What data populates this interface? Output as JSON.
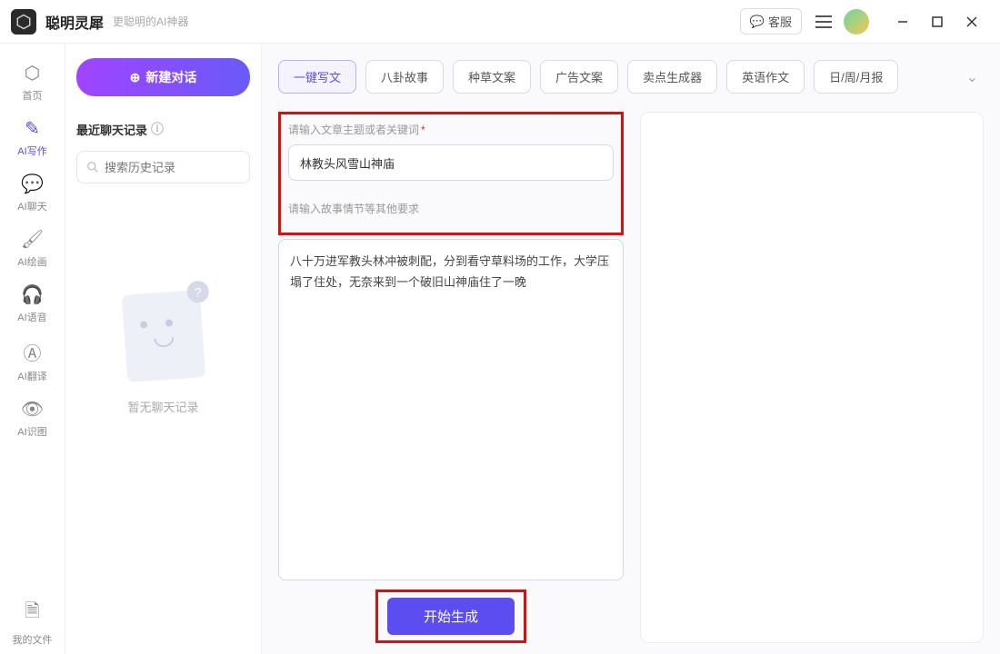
{
  "titlebar": {
    "app_title": "聪明灵犀",
    "app_subtitle": "更聪明的AI神器",
    "kefu_label": "客服"
  },
  "sidebar": {
    "items": [
      {
        "label": "首页",
        "icon": "⬡"
      },
      {
        "label": "AI写作",
        "icon": "✎"
      },
      {
        "label": "AI聊天",
        "icon": "💬"
      },
      {
        "label": "AI绘画",
        "icon": "🖌"
      },
      {
        "label": "AI语音",
        "icon": "🎧"
      },
      {
        "label": "AI翻译",
        "icon": "Ⓐ"
      },
      {
        "label": "AI识图",
        "icon": "👁"
      }
    ],
    "files_label": "我的文件",
    "files_icon": "🗎"
  },
  "left_panel": {
    "new_chat_label": "新建对话",
    "recent_header": "最近聊天记录",
    "search_placeholder": "搜索历史记录",
    "empty_text": "暂无聊天记录"
  },
  "tabs": {
    "items": [
      {
        "label": "一键写文"
      },
      {
        "label": "八卦故事"
      },
      {
        "label": "种草文案"
      },
      {
        "label": "广告文案"
      },
      {
        "label": "卖点生成器"
      },
      {
        "label": "英语作文"
      },
      {
        "label": "日/周/月报"
      }
    ]
  },
  "form": {
    "topic_label": "请输入文章主题或者关键词",
    "topic_value": "林教头风雪山神庙",
    "detail_label": "请输入故事情节等其他要求",
    "detail_value": "八十万进军教头林冲被刺配，分到看守草料场的工作，大学压塌了住处，无奈来到一个破旧山神庙住了一晚",
    "generate_label": "开始生成"
  }
}
